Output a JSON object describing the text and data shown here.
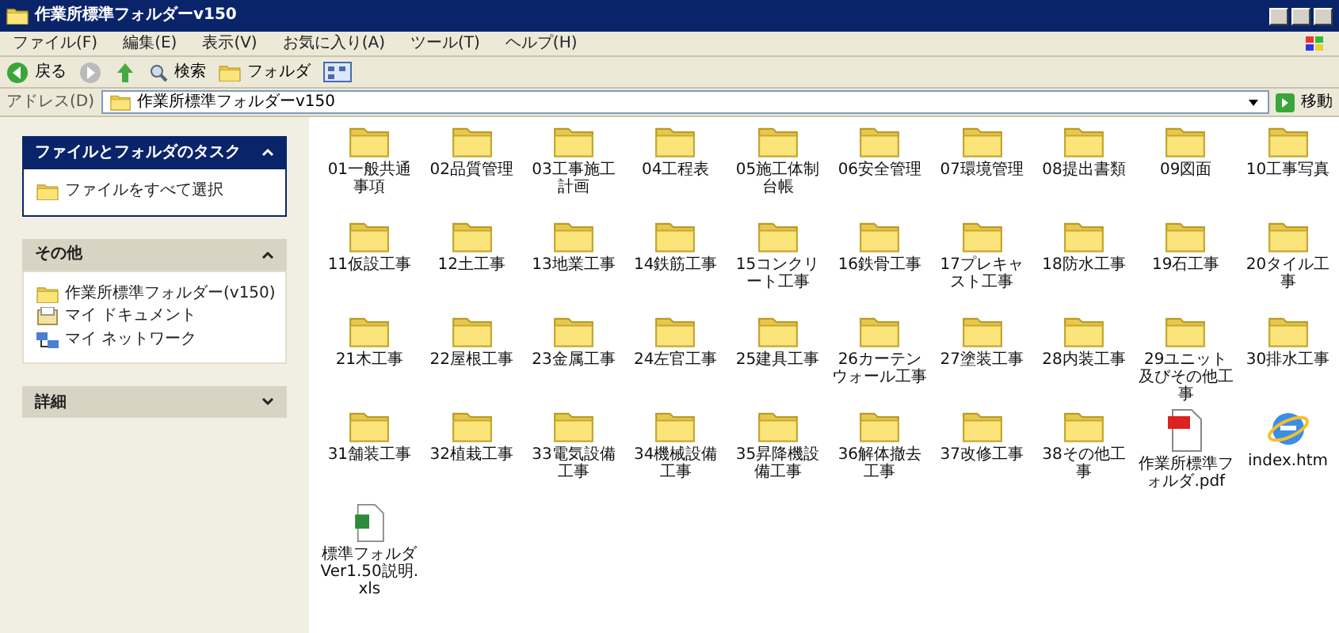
{
  "window": {
    "title": "作業所標準フォルダーv150"
  },
  "menu": [
    "ファイル(F)",
    "編集(E)",
    "表示(V)",
    "お気に入り(A)",
    "ツール(T)",
    "ヘルプ(H)"
  ],
  "toolbar": {
    "back": "戻る",
    "search": "検索",
    "folders": "フォルダ"
  },
  "address": {
    "label": "アドレス(D)",
    "value": "作業所標準フォルダーv150",
    "go": "移動"
  },
  "sidebar": [
    {
      "title": "ファイルとフォルダのタスク",
      "expanded": true,
      "selected": true,
      "items": [
        {
          "kind": "folder",
          "label": "ファイルをすべて選択"
        }
      ]
    },
    {
      "title": "その他",
      "expanded": true,
      "selected": false,
      "items": [
        {
          "kind": "folder",
          "label": "作業所標準フォルダー(v150)"
        },
        {
          "kind": "documents",
          "label": "マイ ドキュメント"
        },
        {
          "kind": "network",
          "label": "マイ ネットワーク"
        }
      ]
    },
    {
      "title": "詳細",
      "expanded": false,
      "selected": false
    }
  ],
  "files": [
    {
      "kind": "folder",
      "name": "01一般共通事項"
    },
    {
      "kind": "folder",
      "name": "02品質管理"
    },
    {
      "kind": "folder",
      "name": "03工事施工計画"
    },
    {
      "kind": "folder",
      "name": "04工程表"
    },
    {
      "kind": "folder",
      "name": "05施工体制台帳"
    },
    {
      "kind": "folder",
      "name": "06安全管理"
    },
    {
      "kind": "folder",
      "name": "07環境管理"
    },
    {
      "kind": "folder",
      "name": "08提出書類"
    },
    {
      "kind": "folder",
      "name": "09図面"
    },
    {
      "kind": "folder",
      "name": "10工事写真"
    },
    {
      "kind": "folder",
      "name": "11仮設工事"
    },
    {
      "kind": "folder",
      "name": "12土工事"
    },
    {
      "kind": "folder",
      "name": "13地業工事"
    },
    {
      "kind": "folder",
      "name": "14鉄筋工事"
    },
    {
      "kind": "folder",
      "name": "15コンクリート工事"
    },
    {
      "kind": "folder",
      "name": "16鉄骨工事"
    },
    {
      "kind": "folder",
      "name": "17プレキャスト工事"
    },
    {
      "kind": "folder",
      "name": "18防水工事"
    },
    {
      "kind": "folder",
      "name": "19石工事"
    },
    {
      "kind": "folder",
      "name": "20タイル工事"
    },
    {
      "kind": "folder",
      "name": "21木工事"
    },
    {
      "kind": "folder",
      "name": "22屋根工事"
    },
    {
      "kind": "folder",
      "name": "23金属工事"
    },
    {
      "kind": "folder",
      "name": "24左官工事"
    },
    {
      "kind": "folder",
      "name": "25建具工事"
    },
    {
      "kind": "folder",
      "name": "26カーテンウォール工事"
    },
    {
      "kind": "folder",
      "name": "27塗装工事"
    },
    {
      "kind": "folder",
      "name": "28内装工事"
    },
    {
      "kind": "folder",
      "name": "29ユニット及びその他工事"
    },
    {
      "kind": "folder",
      "name": "30排水工事"
    },
    {
      "kind": "folder",
      "name": "31舗装工事"
    },
    {
      "kind": "folder",
      "name": "32植栽工事"
    },
    {
      "kind": "folder",
      "name": "33電気設備工事"
    },
    {
      "kind": "folder",
      "name": "34機械設備工事"
    },
    {
      "kind": "folder",
      "name": "35昇降機設備工事"
    },
    {
      "kind": "folder",
      "name": "36解体撤去工事"
    },
    {
      "kind": "folder",
      "name": "37改修工事"
    },
    {
      "kind": "folder",
      "name": "38その他工事"
    },
    {
      "kind": "pdf",
      "name": "作業所標準フォルダ.pdf"
    },
    {
      "kind": "html",
      "name": "index.htm"
    },
    {
      "kind": "excel",
      "name": "標準フォルダVer1.50説明.xls"
    }
  ]
}
